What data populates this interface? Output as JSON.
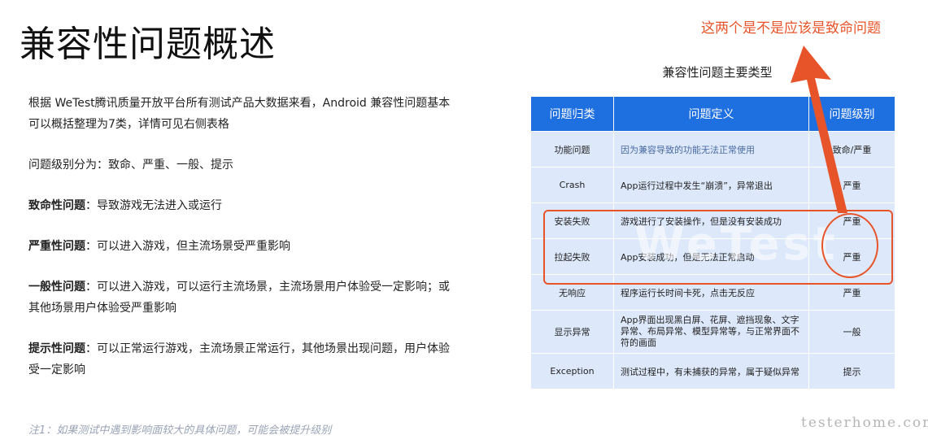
{
  "title": "兼容性问题概述",
  "annotation": "这两个是不是应该是致命问题",
  "intro": "根据 WeTest腾讯质量开放平台所有测试产品大数据来看，Android 兼容性问题基本可以概括整理为7类，详情可见右侧表格",
  "levels": "问题级别分为：致命、严重、一般、提示",
  "definitions": [
    {
      "term": "致命性问题",
      "desc": "：导致游戏无法进入或运行"
    },
    {
      "term": "严重性问题",
      "desc": "：可以进入游戏，但主流场景受严重影响"
    },
    {
      "term": "一般性问题",
      "desc": "：可以进入游戏，可以运行主流场景，主流场景用户体验受一定影响；或其他场景用户体验受严重影响"
    },
    {
      "term": "提示性问题",
      "desc": "：可以正常运行游戏，主流场景正常运行，其他场景出现问题，用户体验受一定影响"
    }
  ],
  "note": "注1：如果测试中遇到影响面较大的具体问题，可能会被提升级别",
  "table": {
    "title": "兼容性问题主要类型",
    "headers": [
      "问题归类",
      "问题定义",
      "问题级别"
    ],
    "rows": [
      {
        "category": "功能问题",
        "definition": "因为兼容导致的功能无法正常使用",
        "level": "致命/严重"
      },
      {
        "category": "Crash",
        "definition": "App运行过程中发生“崩溃”，异常退出",
        "level": "严重"
      },
      {
        "category": "安装失败",
        "definition": "游戏进行了安装操作，但是没有安装成功",
        "level": "严重"
      },
      {
        "category": "拉起失败",
        "definition": "App安装成功，但是无法正常启动",
        "level": "严重"
      },
      {
        "category": "无响应",
        "definition": "程序运行长时间卡死，点击无反应",
        "level": "严重"
      },
      {
        "category": "显示异常",
        "definition": "App界面出现黑白屏、花屏、遮挡现象、文字异常、布局异常、模型异常等，与正常界面不符的画面",
        "level": "一般"
      },
      {
        "category": "Exception",
        "definition": "测试过程中，有未捕获的异常，属于疑似异常",
        "level": "提示"
      }
    ]
  },
  "watermark": "WeTest",
  "footer_watermark": "testerhome.com",
  "colors": {
    "header_bg": "#1e6fe0",
    "cell_bg": "#dde9fb",
    "annotation": "#e8542a"
  }
}
